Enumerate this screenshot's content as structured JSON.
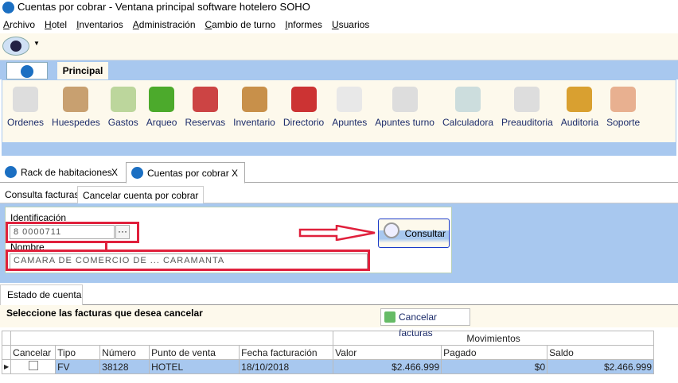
{
  "window": {
    "title": "Cuentas por cobrar - Ventana principal software hotelero SOHO"
  },
  "menu": [
    "Archivo",
    "Hotel",
    "Inventarios",
    "Administración",
    "Cambio de turno",
    "Informes",
    "Usuarios"
  ],
  "ribbon": {
    "tab": "Principal",
    "buttons": [
      {
        "label": "Ordenes",
        "color": "#ddd"
      },
      {
        "label": "Huespedes",
        "color": "#c8a070"
      },
      {
        "label": "Gastos",
        "color": "#bcd69c"
      },
      {
        "label": "Arqueo",
        "color": "#4caa2c"
      },
      {
        "label": "Reservas",
        "color": "#c44"
      },
      {
        "label": "Inventario",
        "color": "#c8904a"
      },
      {
        "label": "Directorio",
        "color": "#c33"
      },
      {
        "label": "Apuntes",
        "color": "#e8e8e8"
      },
      {
        "label": "Apuntes turno",
        "color": "#ddd"
      },
      {
        "label": "Calculadora",
        "color": "#cdd"
      },
      {
        "label": "Preauditoria",
        "color": "#ddd"
      },
      {
        "label": "Auditoria",
        "color": "#d9a030"
      },
      {
        "label": "Soporte",
        "color": "#e8b090"
      }
    ]
  },
  "doc_tabs": [
    {
      "label": "Rack de habitaciones",
      "close": "X"
    },
    {
      "label": "Cuentas por cobrar",
      "close": "X"
    }
  ],
  "sub_tabs": [
    "Consulta facturas",
    "Cancelar cuenta por cobrar"
  ],
  "form": {
    "id_label": "Identificación",
    "id_value": "8 0000711",
    "browse": "···",
    "name_label": "Nombre",
    "name_value": "CAMARA DE COMERCIO DE ... CARAMANTA",
    "consultar": "Consultar"
  },
  "estado": {
    "tab": "Estado de cuenta",
    "prompt": "Seleccione las facturas que desea cancelar",
    "cancel_button": "Cancelar facturas"
  },
  "grid": {
    "group": "Movimientos",
    "columns": [
      "Cancelar",
      "Tipo",
      "Número",
      "Punto de venta",
      "Fecha facturación",
      "Valor",
      "Pagado",
      "Saldo"
    ],
    "rows": [
      {
        "cancelar": false,
        "tipo": "FV",
        "numero": "38128",
        "punto": "HOTEL",
        "fecha": "18/10/2018",
        "valor": "$2.466.999",
        "pagado": "$0",
        "saldo": "$2.466.999"
      }
    ]
  },
  "colors": {
    "ribbon_blue": "#a8c8ef",
    "cream": "#fdf9ec",
    "highlight_red": "#e0203c"
  }
}
